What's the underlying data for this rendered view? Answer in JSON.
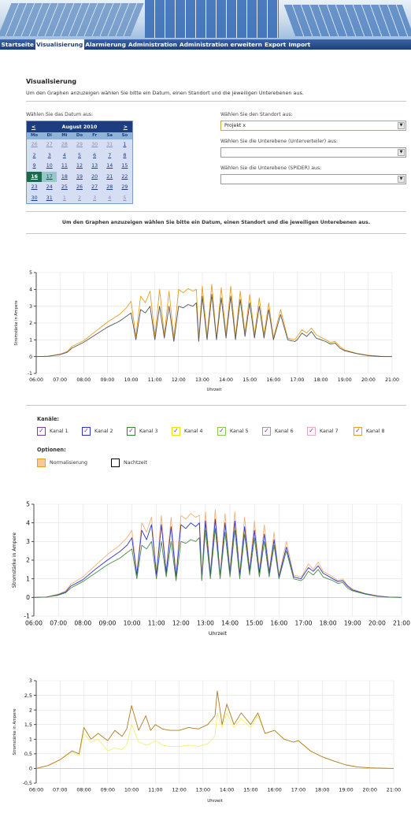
{
  "navigation": {
    "items": [
      "Startseite",
      "Visualisierung",
      "Alarmierung",
      "Administration",
      "Administration erweitern",
      "Export",
      "Import"
    ],
    "active_index": 1
  },
  "page": {
    "title": "Visualisierung",
    "intro": "Um den Graphen anzuzeigen wählen Sie bitte ein Datum, einen Standort und die jeweiligen Unterebenen aus.",
    "notice": "Um den Graphen anzuzeigen wählen Sie bitte ein Datum, einen Standort und die jeweiligen Unterebenen aus."
  },
  "date_picker": {
    "label": "Wählen Sie das Datum aus:",
    "month_label": "August 2010",
    "prev": "<",
    "next": ">",
    "weekdays": [
      "Mo",
      "Di",
      "Mi",
      "Do",
      "Fr",
      "Sa",
      "So"
    ],
    "days": [
      "26",
      "27",
      "28",
      "29",
      "30",
      "31",
      "1",
      "2",
      "3",
      "4",
      "5",
      "6",
      "7",
      "8",
      "9",
      "10",
      "11",
      "12",
      "13",
      "14",
      "15",
      "16",
      "17",
      "18",
      "19",
      "20",
      "21",
      "22",
      "23",
      "24",
      "25",
      "26",
      "27",
      "28",
      "29",
      "30",
      "31",
      "1",
      "2",
      "3",
      "4",
      "5"
    ],
    "leading_other_month": 6,
    "trailing_other_month": 5,
    "selected_day": 16,
    "hover_day": 17
  },
  "selectors": {
    "location_label": "Wählen Sie den Standort aus:",
    "location_value": "Projekt x",
    "sublevel1_label": "Wählen Sie die Unterebene (Unterverteiler) aus:",
    "sublevel1_value": "",
    "sublevel2_label": "Wählen Sie die Unterebene (SPIDER) aus:",
    "sublevel2_value": ""
  },
  "options": {
    "channels_label": "Kanäle:",
    "channels": [
      {
        "label": "Kanal 1",
        "color": "#7a3ab0",
        "checked": true
      },
      {
        "label": "Kanal 2",
        "color": "#2a35c6",
        "checked": true
      },
      {
        "label": "Kanal 3",
        "color": "#2f8a2f",
        "checked": true
      },
      {
        "label": "Kanal 4",
        "color": "#e6e600",
        "checked": true
      },
      {
        "label": "Kanal 5",
        "color": "#8acb4a",
        "checked": true
      },
      {
        "label": "Kanal 6",
        "color": "#9a9a9a",
        "checked": true
      },
      {
        "label": "Kanal 7",
        "color": "#e8a6c8",
        "checked": true
      },
      {
        "label": "Kanal 8",
        "color": "#e8a020",
        "checked": true
      }
    ],
    "options_label": "Optionen:",
    "normalize_label": "Normalisierung",
    "normalize_checked": false,
    "nighttime_label": "Nachtzeit",
    "nighttime_checked": false
  },
  "chart_data": [
    {
      "type": "line",
      "xlabel": "Uhrzeit",
      "ylabel": "Stromstärke in Ampere",
      "xticks": [
        "06:00",
        "07:00",
        "08:00",
        "09:00",
        "10:00",
        "11:00",
        "12:00",
        "13:00",
        "14:00",
        "15:00",
        "16:00",
        "17:00",
        "18:00",
        "19:00",
        "20:00",
        "21:00"
      ],
      "xlim": [
        6,
        21
      ],
      "ylim": [
        -1,
        5
      ],
      "yticks": [
        -1,
        0,
        1,
        2,
        3,
        4,
        5
      ],
      "ytick_labels": [
        "-1",
        "0",
        "1",
        "2",
        "3",
        "4",
        "5"
      ],
      "grid": true,
      "series": [
        {
          "color": "#e8a020",
          "x": [
            6,
            6.5,
            7,
            7.3,
            7.5,
            8,
            8.5,
            9,
            9.5,
            9.8,
            10,
            10.2,
            10.4,
            10.6,
            10.8,
            11,
            11.2,
            11.4,
            11.6,
            11.8,
            12,
            12.2,
            12.4,
            12.6,
            12.75,
            12.85,
            13,
            13.2,
            13.4,
            13.6,
            13.8,
            14,
            14.2,
            14.4,
            14.6,
            14.8,
            15,
            15.2,
            15.4,
            15.6,
            15.8,
            16,
            16.3,
            16.6,
            16.9,
            17,
            17.2,
            17.4,
            17.6,
            17.8,
            18,
            18.2,
            18.4,
            18.6,
            18.8,
            19,
            19.5,
            20,
            20.5,
            21
          ],
          "y": [
            0,
            0.02,
            0.15,
            0.3,
            0.6,
            0.95,
            1.5,
            2.05,
            2.5,
            2.9,
            3.3,
            1.2,
            3.6,
            3.2,
            3.9,
            1.2,
            4.0,
            1.3,
            3.9,
            1.1,
            4.0,
            3.8,
            4.05,
            3.9,
            4.0,
            1.0,
            4.2,
            1.2,
            4.3,
            1.1,
            4.1,
            1.3,
            4.2,
            1.2,
            3.9,
            1.4,
            3.7,
            1.3,
            3.5,
            1.3,
            3.2,
            1.1,
            2.8,
            1.1,
            1.0,
            1.2,
            1.6,
            1.4,
            1.7,
            1.3,
            1.15,
            1.0,
            0.85,
            0.9,
            0.6,
            0.4,
            0.2,
            0.08,
            0.02,
            0
          ]
        },
        {
          "color": "#555555",
          "x": [
            6,
            6.5,
            7,
            7.3,
            7.5,
            8,
            8.5,
            9,
            9.5,
            9.8,
            10,
            10.2,
            10.4,
            10.6,
            10.8,
            11,
            11.2,
            11.4,
            11.6,
            11.8,
            12,
            12.2,
            12.4,
            12.6,
            12.75,
            12.85,
            13,
            13.2,
            13.4,
            13.6,
            13.8,
            14,
            14.2,
            14.4,
            14.6,
            14.8,
            15,
            15.2,
            15.4,
            15.6,
            15.8,
            16,
            16.3,
            16.6,
            16.9,
            17,
            17.2,
            17.4,
            17.6,
            17.8,
            18,
            18.2,
            18.4,
            18.6,
            18.8,
            19,
            19.5,
            20,
            20.5,
            21
          ],
          "y": [
            0,
            0.02,
            0.12,
            0.25,
            0.5,
            0.85,
            1.3,
            1.75,
            2.1,
            2.4,
            2.6,
            1.0,
            2.8,
            2.6,
            3.0,
            1.0,
            3.0,
            1.1,
            3.0,
            0.9,
            3.0,
            2.9,
            3.1,
            3.0,
            3.2,
            0.9,
            3.6,
            1.0,
            3.7,
            1.0,
            3.5,
            1.1,
            3.6,
            1.0,
            3.4,
            1.2,
            3.2,
            1.1,
            3.0,
            1.1,
            2.8,
            1.0,
            2.5,
            1.0,
            0.9,
            1.0,
            1.4,
            1.2,
            1.5,
            1.1,
            1.0,
            0.9,
            0.75,
            0.8,
            0.5,
            0.35,
            0.18,
            0.06,
            0.01,
            0
          ]
        }
      ]
    },
    {
      "type": "line",
      "xlabel": "Uhrzeit",
      "ylabel": "Stromstärke in Ampere",
      "xticks": [
        "06:00",
        "07:00",
        "08:00",
        "09:00",
        "10:00",
        "11:00",
        "12:00",
        "13:00",
        "14:00",
        "15:00",
        "16:00",
        "17:00",
        "18:00",
        "19:00",
        "20:00",
        "21:00"
      ],
      "xlim": [
        6,
        21
      ],
      "ylim": [
        -1,
        5
      ],
      "yticks": [
        -1,
        0,
        1,
        2,
        3,
        4,
        5
      ],
      "ytick_labels": [
        "-1",
        "0",
        "1",
        "2",
        "3",
        "4",
        "5"
      ],
      "grid": true,
      "series": [
        {
          "color": "#f3b07a",
          "x": [
            6,
            6.5,
            7,
            7.3,
            7.5,
            8,
            8.5,
            9,
            9.5,
            9.8,
            10,
            10.2,
            10.4,
            10.6,
            10.8,
            11,
            11.2,
            11.4,
            11.6,
            11.8,
            12,
            12.2,
            12.4,
            12.6,
            12.75,
            12.85,
            13,
            13.2,
            13.4,
            13.6,
            13.8,
            14,
            14.2,
            14.4,
            14.6,
            14.8,
            15,
            15.2,
            15.4,
            15.6,
            15.8,
            16,
            16.3,
            16.6,
            16.9,
            17,
            17.2,
            17.4,
            17.6,
            17.8,
            18,
            18.2,
            18.4,
            18.6,
            18.8,
            19,
            19.5,
            20,
            20.5,
            21
          ],
          "y": [
            0,
            0.02,
            0.18,
            0.35,
            0.7,
            1.1,
            1.7,
            2.3,
            2.8,
            3.2,
            3.6,
            1.3,
            4.0,
            3.5,
            4.3,
            1.3,
            4.4,
            1.4,
            4.3,
            1.2,
            4.4,
            4.2,
            4.5,
            4.3,
            4.4,
            1.1,
            4.6,
            1.3,
            4.7,
            1.2,
            4.5,
            1.4,
            4.6,
            1.3,
            4.3,
            1.5,
            4.1,
            1.4,
            3.9,
            1.4,
            3.5,
            1.2,
            3.0,
            1.2,
            1.1,
            1.3,
            1.8,
            1.5,
            1.9,
            1.4,
            1.25,
            1.1,
            0.9,
            1.0,
            0.65,
            0.45,
            0.22,
            0.09,
            0.02,
            0
          ]
        },
        {
          "color": "#2a35c6",
          "x": [
            6,
            6.5,
            7,
            7.3,
            7.5,
            8,
            8.5,
            9,
            9.5,
            9.8,
            10,
            10.2,
            10.4,
            10.6,
            10.8,
            11,
            11.2,
            11.4,
            11.6,
            11.8,
            12,
            12.2,
            12.4,
            12.6,
            12.75,
            12.85,
            13,
            13.2,
            13.4,
            13.6,
            13.8,
            14,
            14.2,
            14.4,
            14.6,
            14.8,
            15,
            15.2,
            15.4,
            15.6,
            15.8,
            16,
            16.3,
            16.6,
            16.9,
            17,
            17.2,
            17.4,
            17.6,
            17.8,
            18,
            18.2,
            18.4,
            18.6,
            18.8,
            19,
            19.5,
            20,
            20.5,
            21
          ],
          "y": [
            0,
            0.02,
            0.15,
            0.3,
            0.6,
            0.95,
            1.5,
            2.0,
            2.45,
            2.8,
            3.2,
            1.2,
            3.6,
            3.1,
            3.9,
            1.2,
            3.9,
            1.3,
            3.8,
            1.1,
            3.9,
            3.7,
            4.0,
            3.8,
            4.0,
            1.0,
            4.1,
            1.2,
            4.2,
            1.1,
            4.0,
            1.3,
            4.1,
            1.2,
            3.8,
            1.4,
            3.6,
            1.3,
            3.4,
            1.3,
            3.1,
            1.1,
            2.7,
            1.1,
            1.0,
            1.2,
            1.6,
            1.4,
            1.7,
            1.3,
            1.15,
            1.0,
            0.85,
            0.9,
            0.6,
            0.4,
            0.2,
            0.08,
            0.02,
            0
          ]
        },
        {
          "color": "#4a8a4a",
          "x": [
            6,
            6.5,
            7,
            7.3,
            7.5,
            8,
            8.5,
            9,
            9.5,
            9.8,
            10,
            10.2,
            10.4,
            10.6,
            10.8,
            11,
            11.2,
            11.4,
            11.6,
            11.8,
            12,
            12.2,
            12.4,
            12.6,
            12.75,
            12.85,
            13,
            13.2,
            13.4,
            13.6,
            13.8,
            14,
            14.2,
            14.4,
            14.6,
            14.8,
            15,
            15.2,
            15.4,
            15.6,
            15.8,
            16,
            16.3,
            16.6,
            16.9,
            17,
            17.2,
            17.4,
            17.6,
            17.8,
            18,
            18.2,
            18.4,
            18.6,
            18.8,
            19,
            19.5,
            20,
            20.5,
            21
          ],
          "y": [
            0,
            0.02,
            0.12,
            0.25,
            0.5,
            0.85,
            1.3,
            1.75,
            2.1,
            2.4,
            2.6,
            1.0,
            2.8,
            2.6,
            3.0,
            1.0,
            3.0,
            1.1,
            3.0,
            0.9,
            3.0,
            2.9,
            3.1,
            3.0,
            3.2,
            0.9,
            3.6,
            1.0,
            3.7,
            1.0,
            3.5,
            1.1,
            3.6,
            1.0,
            3.4,
            1.2,
            3.2,
            1.1,
            3.0,
            1.1,
            2.8,
            1.0,
            2.5,
            1.0,
            0.9,
            1.0,
            1.4,
            1.2,
            1.5,
            1.1,
            1.0,
            0.9,
            0.75,
            0.8,
            0.5,
            0.35,
            0.18,
            0.06,
            0.01,
            0
          ]
        }
      ]
    },
    {
      "type": "line",
      "xlabel": "Uhrzeit",
      "ylabel": "Stromstärke in Ampere",
      "xticks": [
        "06:00",
        "07:00",
        "08:00",
        "09:00",
        "10:00",
        "11:00",
        "12:00",
        "13:00",
        "14:00",
        "15:00",
        "16:00",
        "17:00",
        "18:00",
        "19:00",
        "20:00",
        "21:00"
      ],
      "xlim": [
        6,
        21
      ],
      "ylim": [
        -0.5,
        3
      ],
      "yticks": [
        -0.5,
        0,
        0.5,
        1,
        1.5,
        2,
        2.5,
        3
      ],
      "ytick_labels": [
        "-0,5",
        "0",
        "0,5",
        "1",
        "1,5",
        "2",
        "2,5",
        "3"
      ],
      "grid": true,
      "series": [
        {
          "color": "#f4f06a",
          "x": [
            6,
            6.5,
            7,
            7.5,
            7.8,
            8,
            8.3,
            8.6,
            9,
            9.3,
            9.6,
            9.8,
            10,
            10.3,
            10.6,
            10.8,
            11,
            11.3,
            11.6,
            12,
            12.4,
            12.8,
            13.2,
            13.5,
            13.6,
            13.8,
            14,
            14.3,
            14.6,
            15,
            15.3,
            15.6,
            16,
            16.4,
            16.8,
            17,
            17.5,
            18,
            18.5,
            19,
            19.5,
            20,
            20.5,
            21
          ],
          "y": [
            0,
            0.1,
            0.3,
            0.55,
            0.45,
            1.2,
            0.9,
            1.0,
            0.6,
            0.7,
            0.65,
            0.8,
            1.5,
            0.9,
            0.8,
            0.85,
            0.95,
            0.8,
            0.75,
            0.75,
            0.8,
            0.75,
            0.85,
            1.1,
            1.9,
            1.4,
            1.9,
            1.4,
            1.7,
            1.4,
            1.8,
            1.2,
            1.3,
            1.0,
            0.9,
            0.95,
            0.6,
            0.4,
            0.25,
            0.12,
            0.05,
            0.02,
            0.01,
            0
          ]
        },
        {
          "color": "#b07a20",
          "x": [
            6,
            6.5,
            7,
            7.5,
            7.8,
            8,
            8.3,
            8.6,
            9,
            9.3,
            9.6,
            9.8,
            10,
            10.3,
            10.6,
            10.8,
            11,
            11.3,
            11.6,
            12,
            12.4,
            12.8,
            13.2,
            13.5,
            13.6,
            13.8,
            14,
            14.3,
            14.6,
            15,
            15.3,
            15.6,
            16,
            16.4,
            16.8,
            17,
            17.5,
            18,
            18.5,
            19,
            19.5,
            20,
            20.5,
            21
          ],
          "y": [
            0,
            0.1,
            0.3,
            0.6,
            0.5,
            1.4,
            1.0,
            1.2,
            0.95,
            1.3,
            1.1,
            1.35,
            2.15,
            1.3,
            1.8,
            1.3,
            1.5,
            1.35,
            1.3,
            1.3,
            1.4,
            1.35,
            1.5,
            1.8,
            2.65,
            1.5,
            2.2,
            1.5,
            1.9,
            1.5,
            1.9,
            1.2,
            1.3,
            1.0,
            0.9,
            0.95,
            0.6,
            0.4,
            0.25,
            0.12,
            0.05,
            0.02,
            0.01,
            0
          ]
        }
      ]
    }
  ]
}
